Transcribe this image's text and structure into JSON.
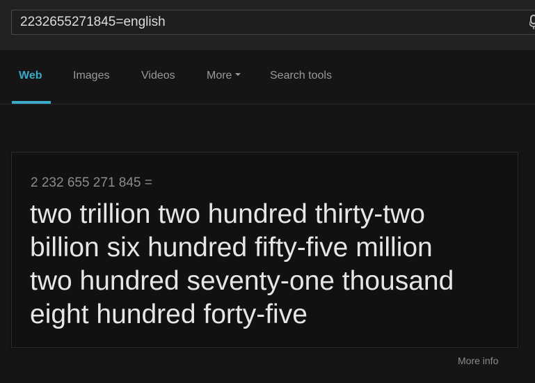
{
  "search": {
    "query": "2232655271845=english"
  },
  "nav": {
    "tabs": [
      {
        "label": "Web"
      },
      {
        "label": "Images"
      },
      {
        "label": "Videos"
      },
      {
        "label": "More"
      },
      {
        "label": "Search tools"
      }
    ],
    "active_tab": "Web"
  },
  "answer": {
    "expression": "2 232 655 271 845 =",
    "result_lines": [
      "two trillion two hundred thirty-two",
      "billion six hundred fifty-five million",
      "two hundred seventy-one thousand",
      "eight hundred forty-five"
    ],
    "more_info": "More info"
  },
  "colors": {
    "background": "#151515",
    "topbar": "#222222",
    "accent": "#3ba9c7",
    "result_text": "#e6e6e6",
    "muted_text": "#8c8c8c"
  },
  "icons": {
    "mic": "microphone-icon"
  }
}
